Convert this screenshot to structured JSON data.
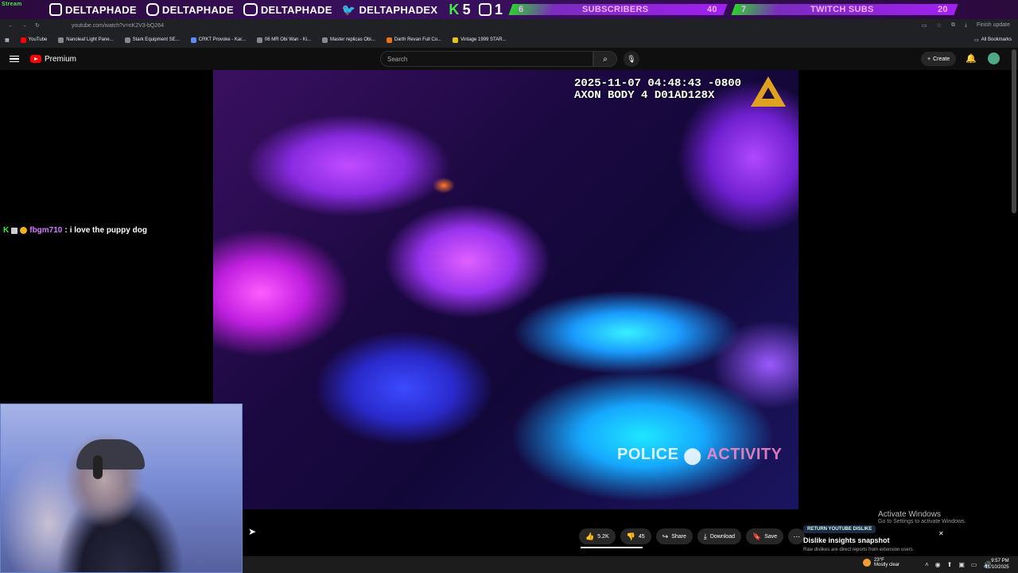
{
  "overlay": {
    "tag": "Stream",
    "socials": [
      "DELTAPHADE",
      "DELTAPHADE",
      "DELTAPHADE",
      "DELTAPHADEX"
    ],
    "k_count": "5",
    "twitch_count": "1",
    "subs": {
      "current": "6",
      "label": "SUBSCRIBERS",
      "goal": "40"
    },
    "twitch_subs": {
      "current": "7",
      "label": "TWITCH SUBS",
      "goal": "20"
    }
  },
  "browser": {
    "url": "youtube.com/watch?v=nK2V3-bQ264",
    "update_label": "Finish update",
    "bookmarks": [
      "YouTube",
      "Nanoleaf Light Pane...",
      "Stark Equipment SE...",
      "CRKT Provoke - Kar...",
      "06 MR Obi Wan - Ki...",
      "Master replicas Obi...",
      "Darth Revan Full Co...",
      "Vintage 1999 STAR..."
    ],
    "all_bookmarks": "All Bookmarks"
  },
  "youtube": {
    "brand": "Premium",
    "search_placeholder": "Search",
    "create_label": "Create"
  },
  "video": {
    "timestamp": "2025-11-07 04:48:43 -0800",
    "device": "AXON BODY 4 D01AD128X",
    "watermark_a": "POLICE",
    "watermark_b": "ACTIVITY"
  },
  "chat": {
    "user": "fbgm710",
    "separator": ":",
    "message": "i love the puppy dog"
  },
  "actions": {
    "likes": "5.2K",
    "dislikes": "45",
    "share": "Share",
    "download": "Download",
    "save": "Save"
  },
  "windows": {
    "activate_title": "Activate Windows",
    "activate_sub": "Go to Settings to activate Windows."
  },
  "ryd": {
    "badge": "RETURN YOUTUBE DISLIKE",
    "title": "Dislike insights snapshot",
    "subtitle": "Raw dislikes are direct reports from extension users"
  },
  "taskbar": {
    "temp": "23°F",
    "weather": "Mostly clear",
    "time": "9:57 PM",
    "date": "11/10/2025"
  }
}
